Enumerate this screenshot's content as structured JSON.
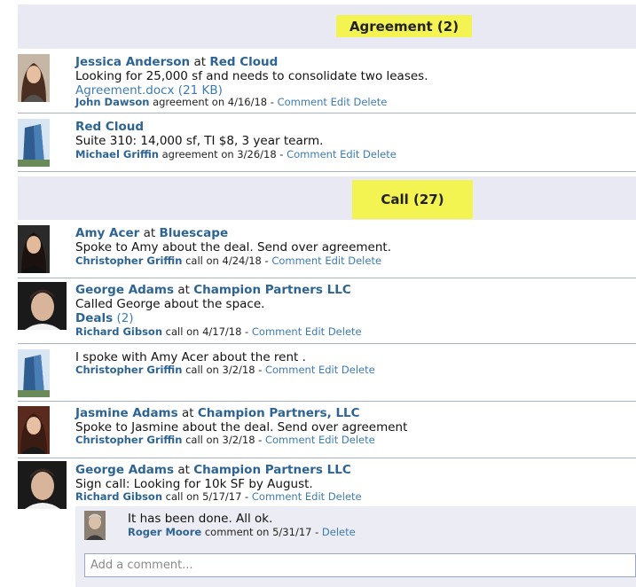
{
  "sections": [
    {
      "label": "Agreement (2)"
    },
    {
      "label": "Call (27)"
    }
  ],
  "entries": [
    {
      "contact": "Jessica Anderson",
      "at": "at",
      "company": "Red Cloud",
      "body": "Looking for 25,000 sf and needs to consolidate two leases.",
      "attachment": "Agreement.docx (21 KB)",
      "author": "John Dawson",
      "action": "agreement on 4/16/18 -",
      "links": [
        "Comment",
        "Edit",
        "Delete"
      ]
    },
    {
      "company": "Red Cloud",
      "body": "Suite 310: 14,000 sf, TI $8, 3 year tearm.",
      "author": "Michael Griffin",
      "action": "agreement on 3/26/18 -",
      "links": [
        "Comment",
        "Edit",
        "Delete"
      ]
    },
    {
      "contact": "Amy Acer",
      "at": "at",
      "company": "Bluescape",
      "body": "Spoke to Amy about the deal. Send over agreement.",
      "author": "Christopher Griffin",
      "action": "call on 4/24/18 -",
      "links": [
        "Comment",
        "Edit",
        "Delete"
      ]
    },
    {
      "contact": "George Adams",
      "at": "at",
      "company": "Champion Partners LLC",
      "body": "Called George about the space.",
      "deals_label": "Deals",
      "deals_count": "(2)",
      "author": "Richard Gibson",
      "action": "call on 4/17/18 -",
      "links": [
        "Comment",
        "Edit",
        "Delete"
      ]
    },
    {
      "body": "I spoke with Amy Acer about the rent .",
      "author": "Christopher Griffin",
      "action": "call on 3/2/18 -",
      "links": [
        "Comment",
        "Edit",
        "Delete"
      ]
    },
    {
      "contact": "Jasmine Adams",
      "at": "at",
      "company": "Champion Partners, LLC",
      "body": "Spoke to Jasmine about the deal. Send over agreement",
      "author": "Christopher Griffin",
      "action": "call on 3/2/18 -",
      "links": [
        "Comment",
        "Edit",
        "Delete"
      ]
    },
    {
      "contact": "George Adams",
      "at": "at",
      "company": "Champion Partners LLC",
      "body": "Sign call: Looking for 10k SF by August.",
      "author": "Richard Gibson",
      "action": "call on 5/17/17 -",
      "links": [
        "Comment",
        "Edit",
        "Delete"
      ]
    }
  ],
  "comment": {
    "text": "It has been done. All ok.",
    "author": "Roger Moore",
    "action": "comment on 5/31/17 -",
    "delete": "Delete"
  },
  "add_comment": {
    "placeholder": "Add a comment..."
  }
}
